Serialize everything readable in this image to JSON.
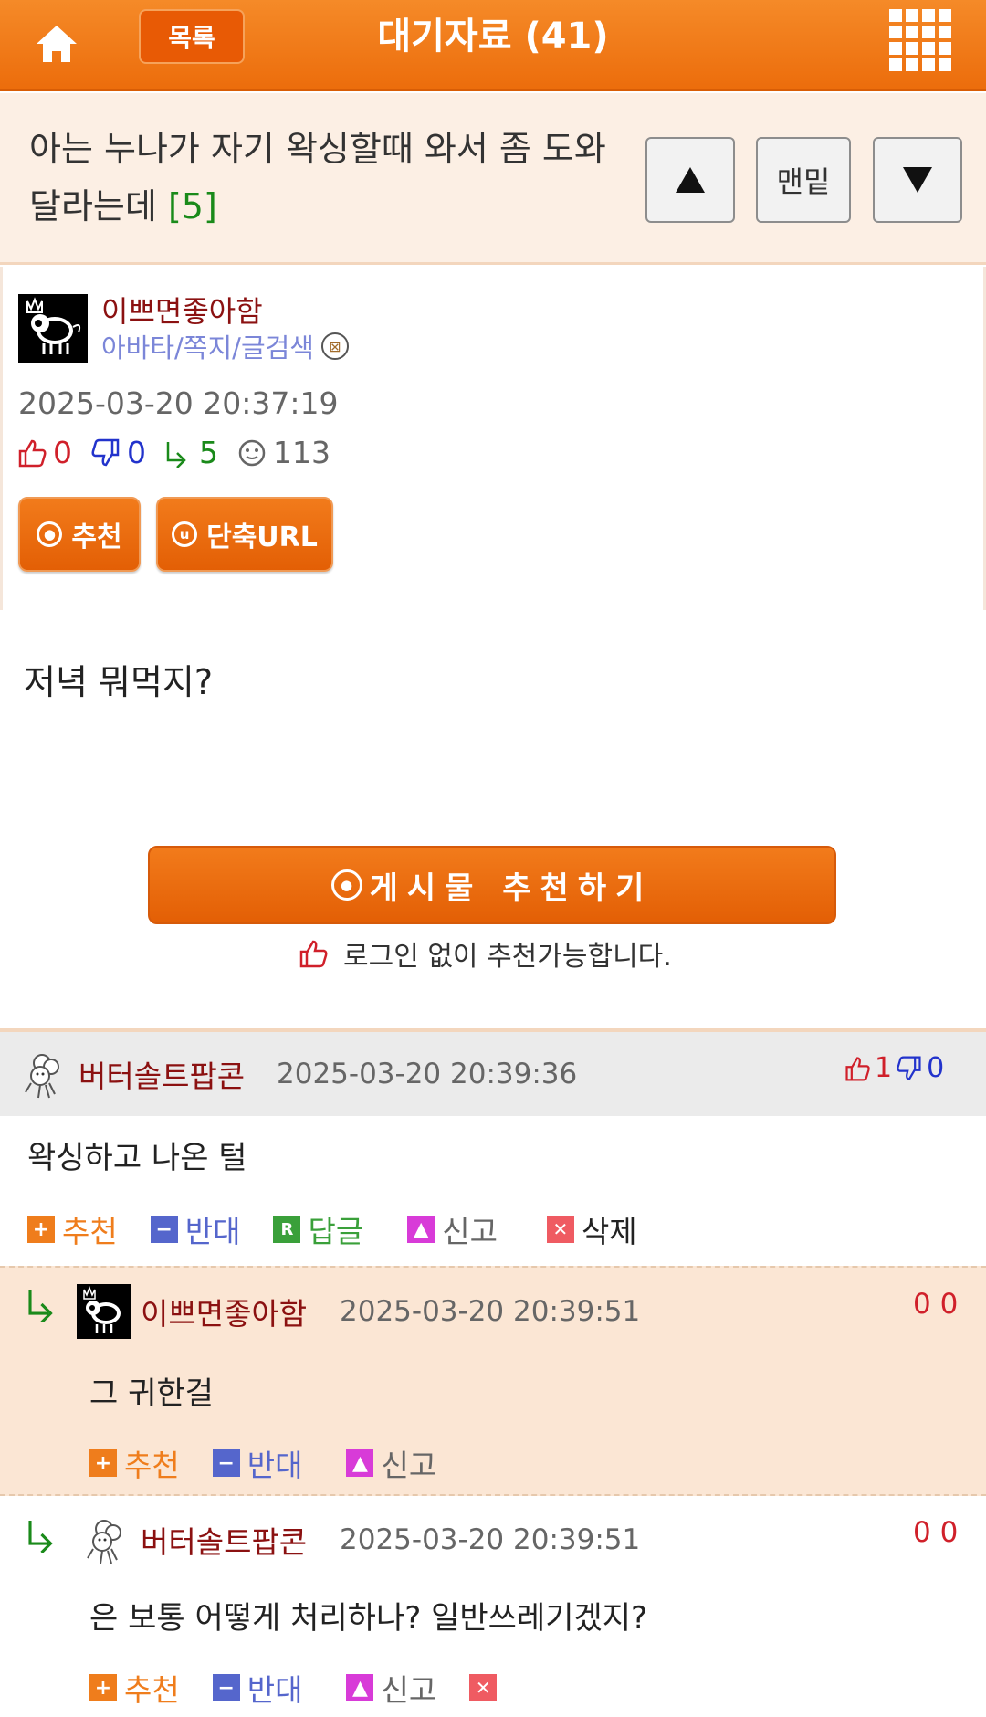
{
  "header": {
    "list_label": "목록",
    "title": "대기자료 (41)"
  },
  "post": {
    "title": "아는 누나가 자기 왁싱할때 와서 좀 도와달라는데",
    "comment_count": "[5]",
    "nav_bottom_label": "맨밑",
    "author": "이쁘면좋아함",
    "author_links": "아바타/쪽지/글검색",
    "date": "2025-03-20 20:37:19",
    "likes": "0",
    "dislikes": "0",
    "replies": "5",
    "views": "113",
    "recommend_label": "추천",
    "short_url_label": "단축URL",
    "content": "저녁 뭐먹지?",
    "big_recommend_label": "게시물 추천하기",
    "recommend_note": "로그인 없이 추천가능합니다."
  },
  "comments": [
    {
      "author": "버터솔트팝콘",
      "date": "2025-03-20 20:39:36",
      "likes": "1",
      "dislikes": "0",
      "body": "왁싱하고 나온 털",
      "actions": {
        "recommend": "추천",
        "oppose": "반대",
        "reply": "답글",
        "report": "신고",
        "delete": "삭제"
      }
    },
    {
      "author": "이쁘면좋아함",
      "date": "2025-03-20 20:39:51",
      "votes": "0 0",
      "body": "그 귀한걸",
      "actions": {
        "recommend": "추천",
        "oppose": "반대",
        "report": "신고"
      }
    },
    {
      "author": "버터솔트팝콘",
      "date": "2025-03-20 20:39:51",
      "votes": "0 0",
      "body": "은 보통 어떻게 처리하나? 일반쓰레기겠지?",
      "actions": {
        "recommend": "추천",
        "oppose": "반대",
        "report": "신고"
      }
    }
  ]
}
